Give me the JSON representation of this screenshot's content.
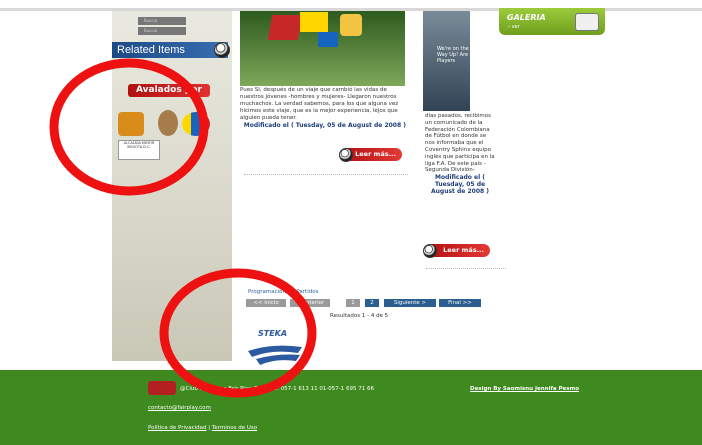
{
  "left": {
    "mini_buttons": [
      "Buscar",
      "Buscar"
    ],
    "related_title": "Related Items",
    "avalados_title": "Avalados por",
    "logo_text": "ALCALDIA MAYOR BOGOTA D.C."
  },
  "news1": {
    "body": "Pues SI, después de un viaje que cambió las vidas de nuestros jóvenes -hombres y mujeres- Llegaron nuestros muchachos. La verdad sabemos, para los que alguna vez hicimos este viaje, que es la mejor experiencia, lejos que alguien pueda tener.",
    "modified": "Modificado el ( Tuesday, 05 de August de 2008 )",
    "read_more": "Leer más..."
  },
  "news2": {
    "photo_caption": "We're on the Way Up! Are Players",
    "body": "días pasados, recibimos un comunicado de la Federación Colombiana de Fútbol en donde se nos informaba que el Coventry Sphinx equipo inglés que participa en la liga F.A. De este país -Segunda División-",
    "modified": "Modificado el ( Tuesday, 05 de August de 2008 )",
    "read_more": "Leer más..."
  },
  "galeria": {
    "title": "GALERIA",
    "sub": "› ver"
  },
  "pagination": {
    "program_link": "Programación de Partidos",
    "start": "<< Inicio",
    "prev": "< Anterior",
    "page1": "1",
    "page2": "2",
    "next": "Siguiente >",
    "end": "Final >>",
    "results": "Resultados 1 - 4 de 5"
  },
  "sponsor": {
    "name": "STEKA"
  },
  "footer": {
    "copyright": "@Club Deportivo Fair Play. Teléfono: 057-1 613 11 01-057-1 695 71 66",
    "design": "Design By Saomisnu Jennifa Pesmo",
    "email": "contacto@fairplay.com",
    "policy": "Política de Privacidad",
    "separator": "|",
    "terms": "Terminos de Uso"
  },
  "annotations": {
    "color": "#ee1111"
  }
}
